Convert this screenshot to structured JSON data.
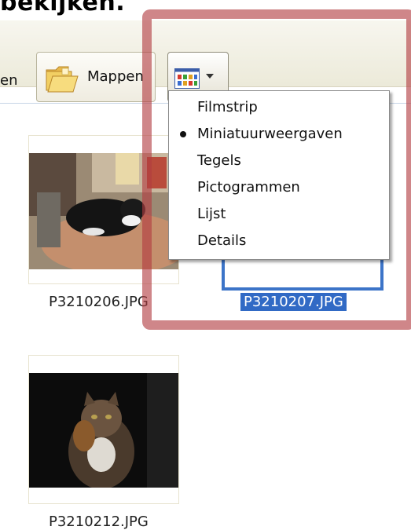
{
  "heading": "bekijken.",
  "toolbar": {
    "prev_button_label": "en",
    "folders_button_label": "Mappen",
    "view_button_icon": "thumbnail-grid-icon",
    "view_dropdown_icon": "chevron-down-icon"
  },
  "view_menu": {
    "items": [
      {
        "label": "Filmstrip",
        "selected": false
      },
      {
        "label": "Miniatuurweergaven",
        "selected": true
      },
      {
        "label": "Tegels",
        "selected": false
      },
      {
        "label": "Pictogrammen",
        "selected": false
      },
      {
        "label": "Lijst",
        "selected": false
      },
      {
        "label": "Details",
        "selected": false
      }
    ]
  },
  "files": [
    {
      "name": "P3210206.JPG",
      "selected": false
    },
    {
      "name": "P3210207.JPG",
      "selected": true
    },
    {
      "name": "P3210212.JPG",
      "selected": false
    }
  ],
  "colors": {
    "selection": "#316ac5",
    "highlight_box": "#b23b41"
  }
}
